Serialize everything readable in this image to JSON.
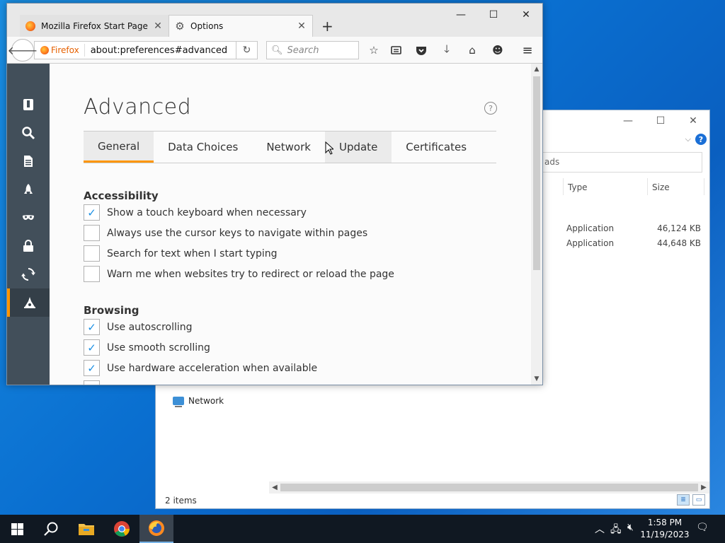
{
  "firefox": {
    "tabs": [
      {
        "label": "Mozilla Firefox Start Page",
        "icon": "firefox-icon"
      },
      {
        "label": "Options",
        "icon": "gear-icon"
      }
    ],
    "window_buttons": {
      "minimize": "—",
      "maximize": "☐",
      "close": "✕"
    },
    "identity_label": "Firefox",
    "url": "about:preferences#advanced",
    "search_placeholder": "Search",
    "page_title": "Advanced",
    "help_glyph": "?",
    "pref_tabs": [
      {
        "label": "General",
        "selected": true
      },
      {
        "label": "Data Choices",
        "selected": false
      },
      {
        "label": "Network",
        "selected": false
      },
      {
        "label": "Update",
        "selected": false
      },
      {
        "label": "Certificates",
        "selected": false
      }
    ],
    "groups": {
      "accessibility": {
        "title": "Accessibility",
        "options": [
          {
            "label": "Show a touch keyboard when necessary",
            "checked": true
          },
          {
            "label": "Always use the cursor keys to navigate within pages",
            "checked": false
          },
          {
            "label": "Search for text when I start typing",
            "checked": false
          },
          {
            "label": "Warn me when websites try to redirect or reload the page",
            "checked": false
          }
        ]
      },
      "browsing": {
        "title": "Browsing",
        "options": [
          {
            "label": "Use autoscrolling",
            "checked": true
          },
          {
            "label": "Use smooth scrolling",
            "checked": true
          },
          {
            "label": "Use hardware acceleration when available",
            "checked": true
          }
        ]
      }
    },
    "check_glyph": "✓",
    "accent_color": "#ff9500"
  },
  "explorer": {
    "search_text": "ads",
    "columns": {
      "type": "Type",
      "size": "Size"
    },
    "files": [
      {
        "type": "Application",
        "size": "46,124 KB"
      },
      {
        "type": "Application",
        "size": "44,648 KB"
      }
    ],
    "nav_network": "Network",
    "status": "2 items"
  },
  "taskbar": {
    "time": "1:58 PM",
    "date": "11/19/2023"
  }
}
